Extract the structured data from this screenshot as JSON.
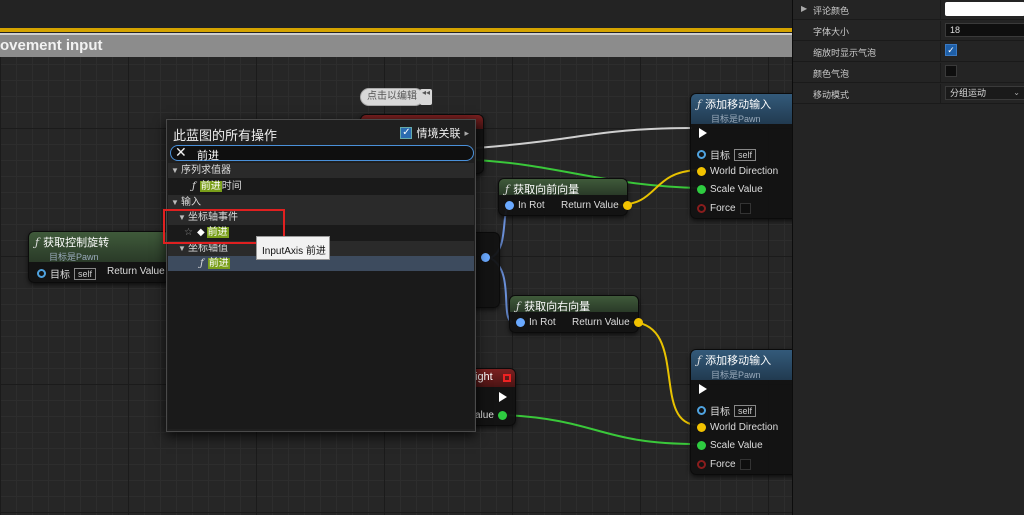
{
  "graph": {
    "comment_title": "ovement input",
    "bubble_label": "点击以编辑",
    "bubble_arrows": "◂◂"
  },
  "nodes": {
    "get_control_rotation": {
      "title": "获取控制旋转",
      "subtitle": "目标是Pawn",
      "target_label": "目标",
      "self_label": "self",
      "return_label": "Return Value"
    },
    "get_forward_vector": {
      "title": "获取向前向量",
      "in_label": "In Rot",
      "return_label": "Return Value"
    },
    "get_right_vector": {
      "title": "获取向右向量",
      "in_label": "In Rot",
      "return_label": "Return Value"
    },
    "add_movement_1": {
      "title": "添加移动输入",
      "subtitle": "目标是Pawn",
      "target_label": "目标",
      "self_label": "self",
      "world_dir": "World Direction",
      "scale": "Scale Value",
      "force": "Force"
    },
    "add_movement_2": {
      "title": "添加移动输入",
      "subtitle": "目标是Pawn",
      "target_label": "目标",
      "self_label": "self",
      "world_dir": "World Direction",
      "scale": "Scale Value",
      "force": "Force"
    },
    "input_axis_right": {
      "title_fragment": "ight",
      "value_fragment": "alue"
    }
  },
  "context_menu": {
    "title": "此蓝图的所有操作",
    "context_sensitive_label": "情境关联",
    "context_sensitive_checked": true,
    "search_query": "前进",
    "items": [
      {
        "kind": "category",
        "label": "序列求值器"
      },
      {
        "kind": "item",
        "prefix": "",
        "highlight": "前进",
        "suffix": "时间"
      },
      {
        "kind": "category",
        "label": "输入"
      },
      {
        "kind": "category",
        "label": "坐标轴事件"
      },
      {
        "kind": "item",
        "prefix": "",
        "highlight": "前进",
        "suffix": ""
      },
      {
        "kind": "category",
        "label": "坐标轴值"
      },
      {
        "kind": "item",
        "prefix": "",
        "highlight": "前进",
        "suffix": ""
      }
    ],
    "tooltip": "InputAxis 前进"
  },
  "details_panel": {
    "rows": [
      {
        "label": "评论颜色",
        "type": "color",
        "value": ""
      },
      {
        "label": "字体大小",
        "type": "number",
        "value": "18"
      },
      {
        "label": "缩放时显示气泡",
        "type": "checkbox",
        "checked": true
      },
      {
        "label": "颜色气泡",
        "type": "checkbox",
        "checked": false
      },
      {
        "label": "移动模式",
        "type": "dropdown",
        "value": "分组运动"
      }
    ]
  }
}
